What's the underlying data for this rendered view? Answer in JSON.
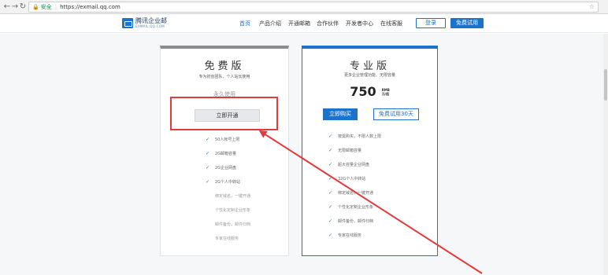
{
  "browser": {
    "back_icon": "back-arrow-icon",
    "forward_icon": "forward-arrow-icon",
    "reload_icon": "reload-icon",
    "secure_label": "安全",
    "url": "https://exmail.qq.com",
    "bookmark_icon": "star-icon"
  },
  "header": {
    "logo_text": "腾讯企业邮",
    "logo_sub": "EXMAIL.QQ.COM",
    "nav": [
      "首页",
      "产品介绍",
      "开通邮箱",
      "合作伙伴",
      "开发者中心",
      "在线客服"
    ],
    "login_label": "登录",
    "trial_label": "免费试用",
    "accent": "#1d73c9"
  },
  "free_plan": {
    "title": "免费版",
    "subtitle": "专为初创团队、个人站长使用",
    "forever": "永久使用",
    "button": "立即开通",
    "features": [
      "50人帐号上限",
      "2G邮箱容量",
      "2G企业网盘",
      "2G个人中转站"
    ],
    "extras": [
      "绑定域名，一键开通",
      "个性化定制企业形象",
      "邮件备份，邮件归档",
      "专家在线服务"
    ]
  },
  "pro_plan": {
    "title": "专业版",
    "subtitle": "更多企业管理功能、无限容量",
    "price": "750",
    "price_unit_top": "RMB",
    "price_unit_bottom": "元/起",
    "buy_button": "立即购买",
    "try_button": "免费试用30天",
    "features": [
      "按需购买，不限人数上限",
      "无限邮箱容量",
      "超大容量企业网盘",
      "32G个人中转站",
      "绑定域名，一键开通",
      "个性化定制企业形象",
      "邮件备份，邮件归档",
      "专家在线服务"
    ]
  },
  "annotation": {
    "highlight_color": "#e23b3b"
  }
}
